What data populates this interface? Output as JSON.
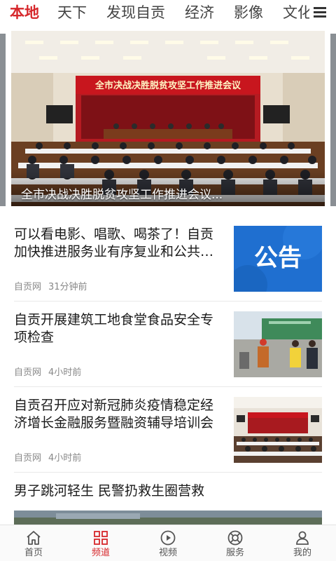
{
  "top_tabs": [
    {
      "label": "本地",
      "active": true
    },
    {
      "label": "天下",
      "active": false
    },
    {
      "label": "发现自贡",
      "active": false
    },
    {
      "label": "经济",
      "active": false
    },
    {
      "label": "影像",
      "active": false
    },
    {
      "label": "文化",
      "active": false
    }
  ],
  "menu_icon": "hamburger-menu-icon",
  "carousel": {
    "banner_text": "全市决战决胜脱贫攻坚工作推进会议",
    "caption": "全市决战决胜脱贫攻坚工作推进会议..."
  },
  "news": [
    {
      "title": "可以看电影、唱歌、喝茶了！自贡加快推进服务业有序复业和公共…",
      "source": "自贡网",
      "time": "31分钟前",
      "thumb_text": "公告"
    },
    {
      "title": "自贡开展建筑工地食堂食品安全专项检查",
      "source": "自贡网",
      "time": "4小时前"
    },
    {
      "title": "自贡召开应对新冠肺炎疫情稳定经济增长金融服务暨融资辅导培训会",
      "source": "自贡网",
      "time": "4小时前"
    },
    {
      "title": "男子跳河轻生 民警扔救生圈营救"
    }
  ],
  "bottom_nav": [
    {
      "label": "首页",
      "icon": "home-icon",
      "active": false
    },
    {
      "label": "频道",
      "icon": "grid-icon",
      "active": true
    },
    {
      "label": "视频",
      "icon": "play-icon",
      "active": false
    },
    {
      "label": "服务",
      "icon": "lifebuoy-icon",
      "active": false
    },
    {
      "label": "我的",
      "icon": "user-icon",
      "active": false
    }
  ],
  "colors": {
    "accent": "#d6272b",
    "thumb_blue": "#1f6fd0"
  }
}
